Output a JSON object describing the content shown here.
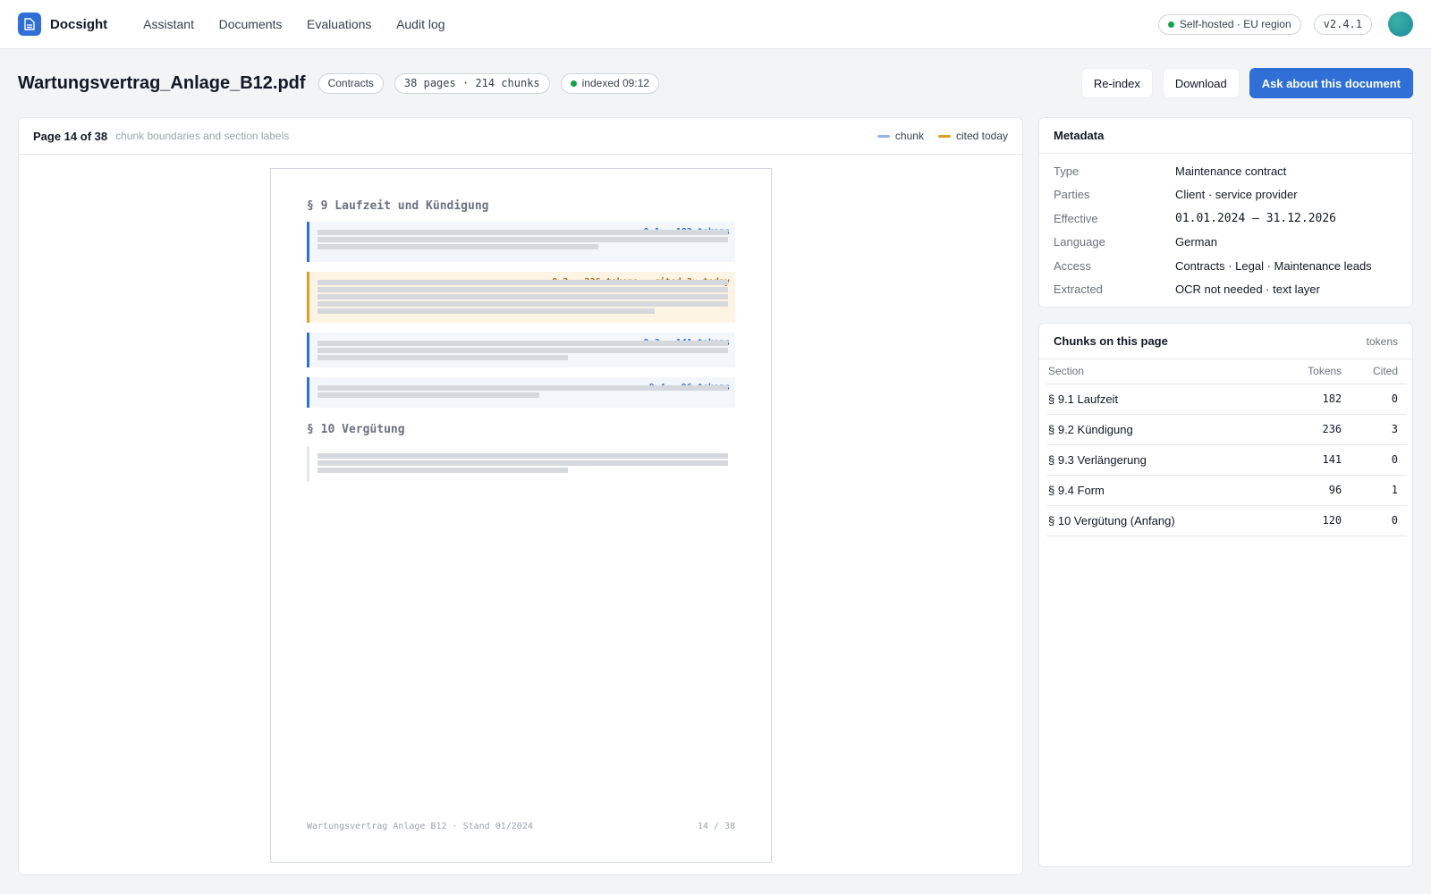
{
  "app": {
    "name": "Docsight",
    "region_badge": "Self-hosted · EU region",
    "version": "v2.4.1"
  },
  "nav": [
    "Assistant",
    "Documents",
    "Evaluations",
    "Audit log"
  ],
  "doc": {
    "title": "Wartungsvertrag_Anlage_B12.pdf",
    "collection": "Contracts",
    "stats": "38 pages · 214 chunks",
    "status": "indexed 09:12",
    "actions": {
      "reindex": "Re-index",
      "download": "Download",
      "ask": "Ask about this document"
    }
  },
  "viewer": {
    "page_label": "Page 14 of 38",
    "subtitle": "chunk boundaries and section labels",
    "legend": {
      "chunk": "chunk",
      "cited": "cited today"
    },
    "sections": {
      "s9": "§ 9 Laufzeit und Kündigung",
      "s10": "§ 10 Vergütung"
    },
    "chunk_labels": [
      "9.1 · 182 tokens",
      "9.2 · 236 tokens · cited 3× today",
      "9.3 · 141 tokens",
      "9.4 · 96 tokens"
    ],
    "footer_left": "Wartungsvertrag Anlage B12 · Stand 01/2024",
    "footer_right": "14 / 38"
  },
  "metadata": {
    "title": "Metadata",
    "rows": [
      {
        "key": "Type",
        "value": "Maintenance contract"
      },
      {
        "key": "Parties",
        "value": "Client · service provider"
      },
      {
        "key": "Effective",
        "value": "01.01.2024 – 31.12.2026"
      },
      {
        "key": "Language",
        "value": "German"
      },
      {
        "key": "Access",
        "value": "Contracts · Legal · Maintenance leads"
      },
      {
        "key": "Extracted",
        "value": "OCR not needed · text layer"
      }
    ]
  },
  "chunks_table": {
    "title": "Chunks on this page",
    "right_label": "tokens",
    "columns": [
      "Section",
      "Tokens",
      "Cited"
    ],
    "rows": [
      {
        "section": "§ 9.1 Laufzeit",
        "tokens": "182",
        "cited": "0"
      },
      {
        "section": "§ 9.2 Kündigung",
        "tokens": "236",
        "cited": "3"
      },
      {
        "section": "§ 9.3 Verlängerung",
        "tokens": "141",
        "cited": "0"
      },
      {
        "section": "§ 9.4 Form",
        "tokens": "96",
        "cited": "1"
      },
      {
        "section": "§ 10 Vergütung (Anfang)",
        "tokens": "120",
        "cited": "0"
      }
    ]
  },
  "colors": {
    "accent": "#2f6fd6",
    "cited": "#d8a024",
    "status_ok": "#16a34a",
    "chunk_legend": "#8fb4e8"
  }
}
